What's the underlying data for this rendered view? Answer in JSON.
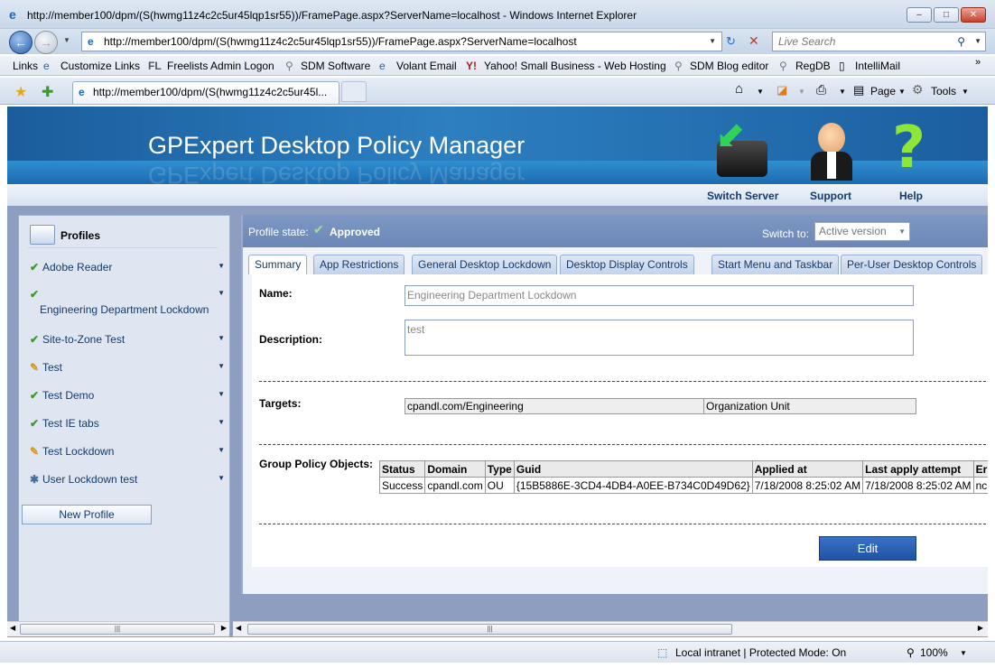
{
  "window": {
    "title": "http://member100/dpm/(S(hwmg11z4c2c5ur45lqp1sr55))/FramePage.aspx?ServerName=localhost - Windows Internet Explorer",
    "address": "http://member100/dpm/(S(hwmg11z4c2c5ur45lqp1sr55))/FramePage.aspx?ServerName=localhost",
    "search_placeholder": "Live Search",
    "tab_title": "http://member100/dpm/(S(hwmg11z4c2c5ur45l..."
  },
  "links_bar": {
    "label": "Links",
    "items": [
      "Customize Links",
      "Freelists Admin Logon",
      "SDM Software",
      "Volant Email",
      "Yahoo! Small Business - Web Hosting",
      "SDM Blog editor",
      "RegDB",
      "IntelliMail"
    ]
  },
  "command_bar": {
    "page": "Page",
    "tools": "Tools"
  },
  "app": {
    "title": "GPExpert Desktop Policy Manager",
    "nav": {
      "switch_server": "Switch Server",
      "support": "Support",
      "help": "Help"
    }
  },
  "sidebar": {
    "heading": "Profiles",
    "profiles": [
      {
        "name": "Adobe Reader",
        "status": "approved"
      },
      {
        "name": "Engineering Department Lockdown",
        "status": "approved"
      },
      {
        "name": "Site-to-Zone Test",
        "status": "approved"
      },
      {
        "name": "Test",
        "status": "draft"
      },
      {
        "name": "Test Demo",
        "status": "approved"
      },
      {
        "name": "Test IE tabs",
        "status": "approved"
      },
      {
        "name": "Test Lockdown",
        "status": "draft"
      },
      {
        "name": "User Lockdown test",
        "status": "other"
      }
    ],
    "new_profile": "New Profile"
  },
  "profile": {
    "state_label": "Profile state:",
    "state": "Approved",
    "switch_to_label": "Switch to:",
    "switch_to_value": "Active version",
    "tabs": [
      "Summary",
      "App Restrictions",
      "General Desktop Lockdown",
      "Desktop Display Controls",
      "Start Menu and Taskbar",
      "Per-User Desktop Controls"
    ],
    "active_tab": "Summary",
    "name_label": "Name:",
    "name_value": "Engineering Department Lockdown",
    "description_label": "Description:",
    "description_value": "test",
    "targets_label": "Targets:",
    "target_path": "cpandl.com/Engineering",
    "target_type": "Organization Unit",
    "gpo_label": "Group Policy Objects:",
    "gpo_columns": [
      "Status",
      "Domain",
      "Type",
      "Guid",
      "Applied at",
      "Last apply attempt",
      "Er"
    ],
    "gpo_rows": [
      [
        "Success",
        "cpandl.com",
        "OU",
        "{15B5886E-3CD4-4DB4-A0EE-B734C0D49D62}",
        "7/18/2008 8:25:02 AM",
        "7/18/2008 8:25:02 AM",
        "nc"
      ]
    ],
    "edit_button": "Edit"
  },
  "statusbar": {
    "zone": "Local intranet | Protected Mode: On",
    "zoom": "100%"
  },
  "colors": {
    "banner": "#2d7fc0",
    "approved_check": "#3a9a2a",
    "edit_button": "#1f52a3"
  }
}
